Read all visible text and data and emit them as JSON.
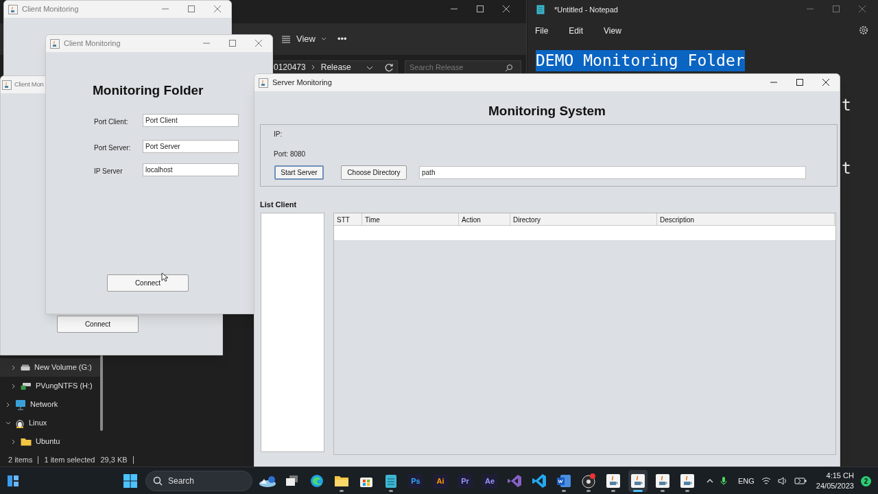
{
  "file_explorer": {
    "toolbar": {
      "view": "View",
      "more": "•••"
    },
    "address": {
      "path_tail": "0120473",
      "current": "Release"
    },
    "search": {
      "placeholder": "Search Release"
    },
    "nav_items": [
      {
        "label": "New Volume (G:)",
        "kind": "drive",
        "selected": true,
        "expanded": false
      },
      {
        "label": "PVungNTFS (H:)",
        "kind": "netdrive",
        "selected": false,
        "expanded": false
      },
      {
        "label": "Network",
        "kind": "network",
        "selected": false,
        "expanded": false
      },
      {
        "label": "Linux",
        "kind": "linux",
        "selected": false,
        "expanded": true,
        "children": [
          {
            "label": "Ubuntu",
            "kind": "folder",
            "selected": false,
            "expanded": false
          }
        ]
      }
    ],
    "status": [
      "2 items",
      "1 item selected",
      "29,3 KB"
    ]
  },
  "notepad": {
    "title": "*Untitled - Notepad",
    "menu": [
      "File",
      "Edit",
      "View"
    ],
    "lines": [
      {
        "text": "DEMO Monitoring Folder",
        "selected": true
      }
    ],
    "line_ends": [
      "t",
      "t"
    ]
  },
  "client_windows": [
    {
      "title": "Client Monitoring"
    },
    {
      "title": "Client Mon",
      "button": "Connect"
    },
    {
      "title": "Client Monitoring",
      "heading": "Monitoring Folder",
      "fields": [
        {
          "label": "Port Client:",
          "value": "Port Client"
        },
        {
          "label": "Port Server:",
          "value": "Port Server"
        },
        {
          "label": "IP Server",
          "value": "localhost"
        }
      ],
      "button": "Connect"
    }
  ],
  "server_window": {
    "title": "Server Monitoring",
    "heading": "Monitoring System",
    "ip_label": "IP:",
    "port_label": "Port: 8080",
    "buttons": [
      {
        "label": "Start Server",
        "focused": true
      },
      {
        "label": "Choose Directory",
        "focused": false
      }
    ],
    "path_value": "path",
    "list_title": "List Client",
    "table": {
      "columns": [
        "STT",
        "Time",
        "Action",
        "Directory",
        "Description"
      ]
    }
  },
  "taskbar": {
    "search": "Search",
    "apps": [
      {
        "kind": "widgets",
        "running": false,
        "selected": false
      },
      {
        "kind": "taskview",
        "running": false,
        "selected": false
      },
      {
        "kind": "edge",
        "running": false,
        "selected": false
      },
      {
        "kind": "explorer",
        "running": true,
        "selected": false
      },
      {
        "kind": "store",
        "running": false,
        "selected": false
      },
      {
        "kind": "notepad",
        "running": true,
        "selected": false
      },
      {
        "kind": "adobe",
        "label": "Ps",
        "color": "#31a8ff",
        "running": false,
        "selected": false
      },
      {
        "kind": "adobe",
        "label": "Ai",
        "color": "#ff9a00",
        "running": false,
        "selected": false
      },
      {
        "kind": "adobe",
        "label": "Pr",
        "color": "#9999ff",
        "running": false,
        "selected": false
      },
      {
        "kind": "adobe",
        "label": "Ae",
        "color": "#9999ff",
        "running": false,
        "selected": false
      },
      {
        "kind": "vs",
        "running": false,
        "selected": false
      },
      {
        "kind": "vscode",
        "running": false,
        "selected": false
      },
      {
        "kind": "word",
        "running": true,
        "selected": false
      },
      {
        "kind": "obs",
        "running": true,
        "selected": false
      },
      {
        "kind": "java",
        "running": true,
        "selected": false
      },
      {
        "kind": "java",
        "running": true,
        "selected": true
      },
      {
        "kind": "java",
        "running": true,
        "selected": false
      },
      {
        "kind": "java",
        "running": true,
        "selected": false
      }
    ],
    "language": "ENG",
    "time": "4:15 CH",
    "date": "24/05/2023",
    "notifications": "2"
  }
}
